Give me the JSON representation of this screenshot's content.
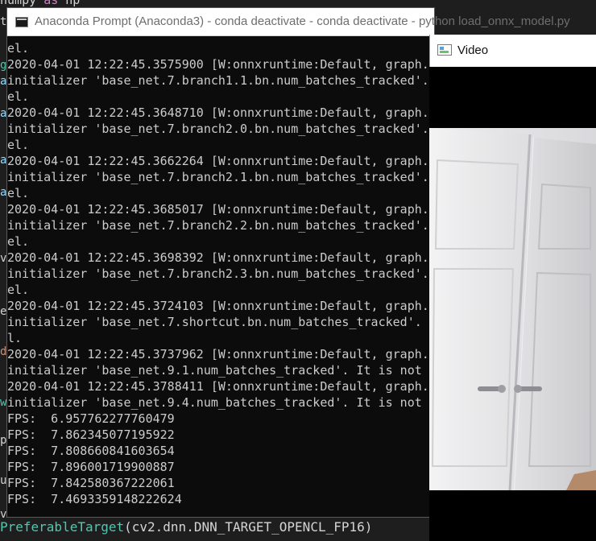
{
  "editor": {
    "top_line": "numpy as np",
    "top_line_prefix": "numpy ",
    "top_line_kw": "as",
    "top_line_suffix": " np",
    "strip_chars": [
      "t",
      "g",
      "a",
      "a",
      "a",
      "a",
      "v",
      "e",
      "d",
      "w",
      "p",
      "u",
      "v"
    ],
    "bottom_line": {
      "fn": "PreferableTarget",
      "args": "(cv2.dnn.DNN_TARGET_OPENCL_FP16)"
    }
  },
  "console": {
    "title": "Anaconda Prompt (Anaconda3) - conda  deactivate - conda  deactivate - python  load_onnx_model.py",
    "lines": [
      "el.",
      "2020-04-01 12:22:45.3575900 [W:onnxruntime:Default, graph.",
      "initializer 'base_net.7.branch1.1.bn.num_batches_tracked'.",
      "el.",
      "2020-04-01 12:22:45.3648710 [W:onnxruntime:Default, graph.",
      "initializer 'base_net.7.branch2.0.bn.num_batches_tracked'.",
      "el.",
      "2020-04-01 12:22:45.3662264 [W:onnxruntime:Default, graph.",
      "initializer 'base_net.7.branch2.1.bn.num_batches_tracked'.",
      "el.",
      "2020-04-01 12:22:45.3685017 [W:onnxruntime:Default, graph.",
      "initializer 'base_net.7.branch2.2.bn.num_batches_tracked'.",
      "el.",
      "2020-04-01 12:22:45.3698392 [W:onnxruntime:Default, graph.",
      "initializer 'base_net.7.branch2.3.bn.num_batches_tracked'.",
      "el.",
      "2020-04-01 12:22:45.3724103 [W:onnxruntime:Default, graph.",
      "initializer 'base_net.7.shortcut.bn.num_batches_tracked'.",
      "l.",
      "2020-04-01 12:22:45.3737962 [W:onnxruntime:Default, graph.",
      "initializer 'base_net.9.1.num_batches_tracked'. It is not",
      "2020-04-01 12:22:45.3788411 [W:onnxruntime:Default, graph.",
      "initializer 'base_net.9.4.num_batches_tracked'. It is not",
      "FPS:  6.957762277760479",
      "FPS:  7.862345077195922",
      "FPS:  7.808660841603654",
      "FPS:  7.896001719900887",
      "FPS:  7.842580367222061",
      "FPS:  7.4693359148222624"
    ]
  },
  "video": {
    "title": "Video"
  },
  "colors": {
    "console_bg": "#0c0c0c",
    "console_text": "#cccccc",
    "editor_bg": "#1e1e1e",
    "keyword": "#c586c0",
    "function": "#4ec9b0"
  }
}
